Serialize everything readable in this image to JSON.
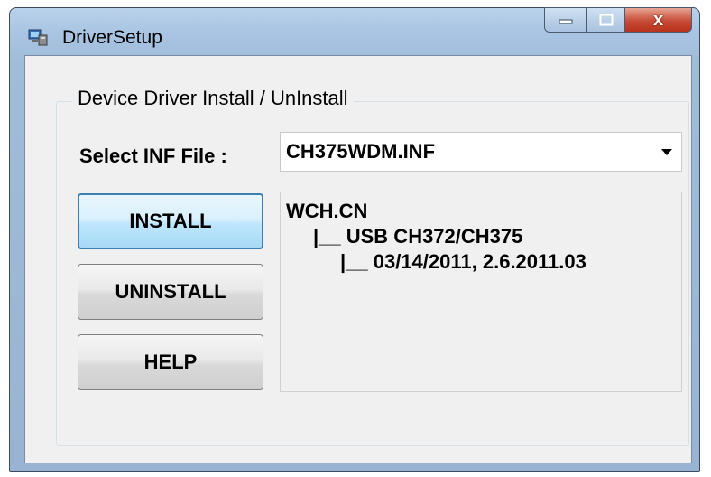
{
  "window": {
    "title": "DriverSetup",
    "app_icon": "computer-setup-icon",
    "controls": {
      "minimize_icon": "minimize-icon",
      "maximize_icon": "maximize-icon",
      "close_icon": "close-icon",
      "close_glyph": "x"
    }
  },
  "group": {
    "title": "Device Driver Install / UnInstall"
  },
  "inf": {
    "label": "Select INF File :",
    "selected": "CH375WDM.INF"
  },
  "buttons": {
    "install": "INSTALL",
    "uninstall": "UNINSTALL",
    "help": "HELP"
  },
  "info": {
    "lines": [
      "WCH.CN",
      "|__ USB CH372/CH375",
      "|__ 03/14/2011, 2.6.2011.03"
    ]
  },
  "colors": {
    "default_button_border": "#3c7fb1",
    "close_button": "#c74b35",
    "dialog_background": "#f0f0f0"
  }
}
